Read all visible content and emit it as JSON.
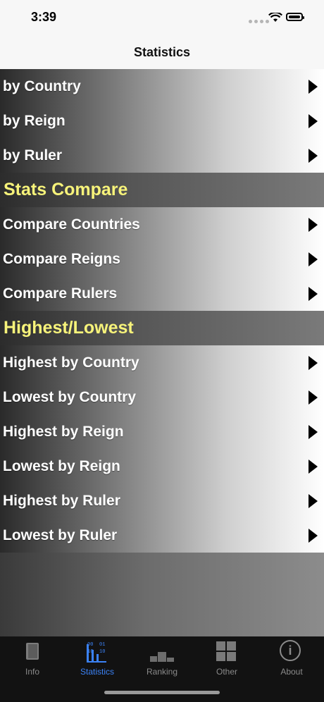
{
  "status_bar": {
    "time": "3:39"
  },
  "nav": {
    "title": "Statistics"
  },
  "list": [
    {
      "type": "row",
      "label": "by Country"
    },
    {
      "type": "row",
      "label": "by Reign"
    },
    {
      "type": "row",
      "label": "by Ruler"
    },
    {
      "type": "section",
      "label": "Stats Compare"
    },
    {
      "type": "row",
      "label": "Compare Countries"
    },
    {
      "type": "row",
      "label": "Compare Reigns"
    },
    {
      "type": "row",
      "label": "Compare Rulers"
    },
    {
      "type": "section",
      "label": "Highest/Lowest"
    },
    {
      "type": "row",
      "label": "Highest by Country"
    },
    {
      "type": "row",
      "label": "Lowest by Country"
    },
    {
      "type": "row",
      "label": "Highest by Reign"
    },
    {
      "type": "row",
      "label": "Lowest by Reign"
    },
    {
      "type": "row",
      "label": "Highest by Ruler"
    },
    {
      "type": "row",
      "label": "Lowest by Ruler"
    }
  ],
  "tabbar": {
    "tabs": [
      {
        "label": "Info",
        "icon": "book-icon"
      },
      {
        "label": "Statistics",
        "icon": "statistics-icon",
        "active": true
      },
      {
        "label": "Ranking",
        "icon": "podium-icon"
      },
      {
        "label": "Other",
        "icon": "grid-icon"
      },
      {
        "label": "About",
        "icon": "info-icon"
      }
    ]
  },
  "colors": {
    "section_text": "#f7f37a",
    "active_tab": "#3b82f6"
  }
}
